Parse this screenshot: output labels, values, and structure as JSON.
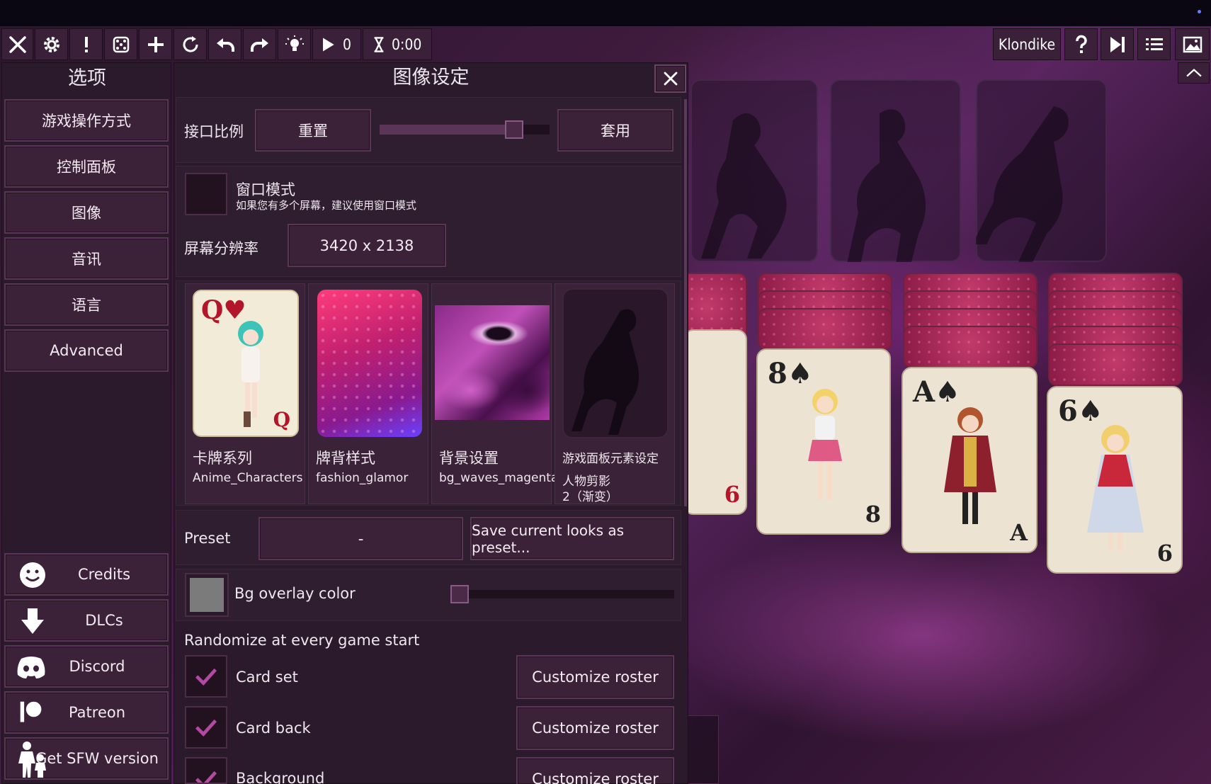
{
  "toolbar": {
    "move_count": "0",
    "timer": "0:00",
    "game_name": "Klondike"
  },
  "options": {
    "title": "选项",
    "items": [
      {
        "label": "游戏操作方式"
      },
      {
        "label": "控制面板"
      },
      {
        "label": "图像"
      },
      {
        "label": "音讯"
      },
      {
        "label": "语言"
      },
      {
        "label": "Advanced"
      }
    ],
    "links": [
      {
        "label": "Credits",
        "icon": "smiley-icon"
      },
      {
        "label": "DLCs",
        "icon": "download-arrow-icon"
      },
      {
        "label": "Discord",
        "icon": "discord-icon"
      },
      {
        "label": "Patreon",
        "icon": "patreon-icon"
      },
      {
        "label": "Get SFW version",
        "icon": "family-icon"
      }
    ]
  },
  "graphics": {
    "title": "图像设定",
    "ui_scale_label": "接口比例",
    "reset_label": "重置",
    "apply_label": "套用",
    "ui_scale_value": 0.79,
    "window_mode_label": "窗口模式",
    "window_mode_hint": "如果您有多个屏幕，建议使用窗口模式",
    "resolution_label": "屏幕分辨率",
    "resolution_value": "3420 x 2138",
    "thumbnails": [
      {
        "title": "卡牌系列",
        "value": "Anime_Characters"
      },
      {
        "title": "牌背样式",
        "value": "fashion_glamor"
      },
      {
        "title": "背景设置",
        "value": "bg_waves_magenta"
      },
      {
        "title": "游戏面板元素设定",
        "value": "人物剪影",
        "value2": "2（渐变）"
      }
    ],
    "preset_label": "Preset",
    "preset_value": "-",
    "save_preset_label": "Save current looks as preset...",
    "bg_overlay_label": "Bg overlay color",
    "bg_overlay_value": 0.0,
    "randomize_label": "Randomize at every game start",
    "randomize_items": [
      {
        "label": "Card set",
        "button": "Customize roster",
        "checked": true
      },
      {
        "label": "Card back",
        "button": "Customize roster",
        "checked": true
      },
      {
        "label": "Background",
        "button": "Customize roster",
        "checked": true
      }
    ]
  },
  "board": {
    "cards": [
      {
        "rank": "6"
      },
      {
        "rank": "8",
        "suit": "♠"
      },
      {
        "rank": "A",
        "suit": "♠"
      },
      {
        "rank": "6",
        "suit": "♠"
      }
    ]
  },
  "colors": {
    "accent": "#b0409a",
    "panel": "#2b1a2b",
    "button": "#3c2239"
  }
}
